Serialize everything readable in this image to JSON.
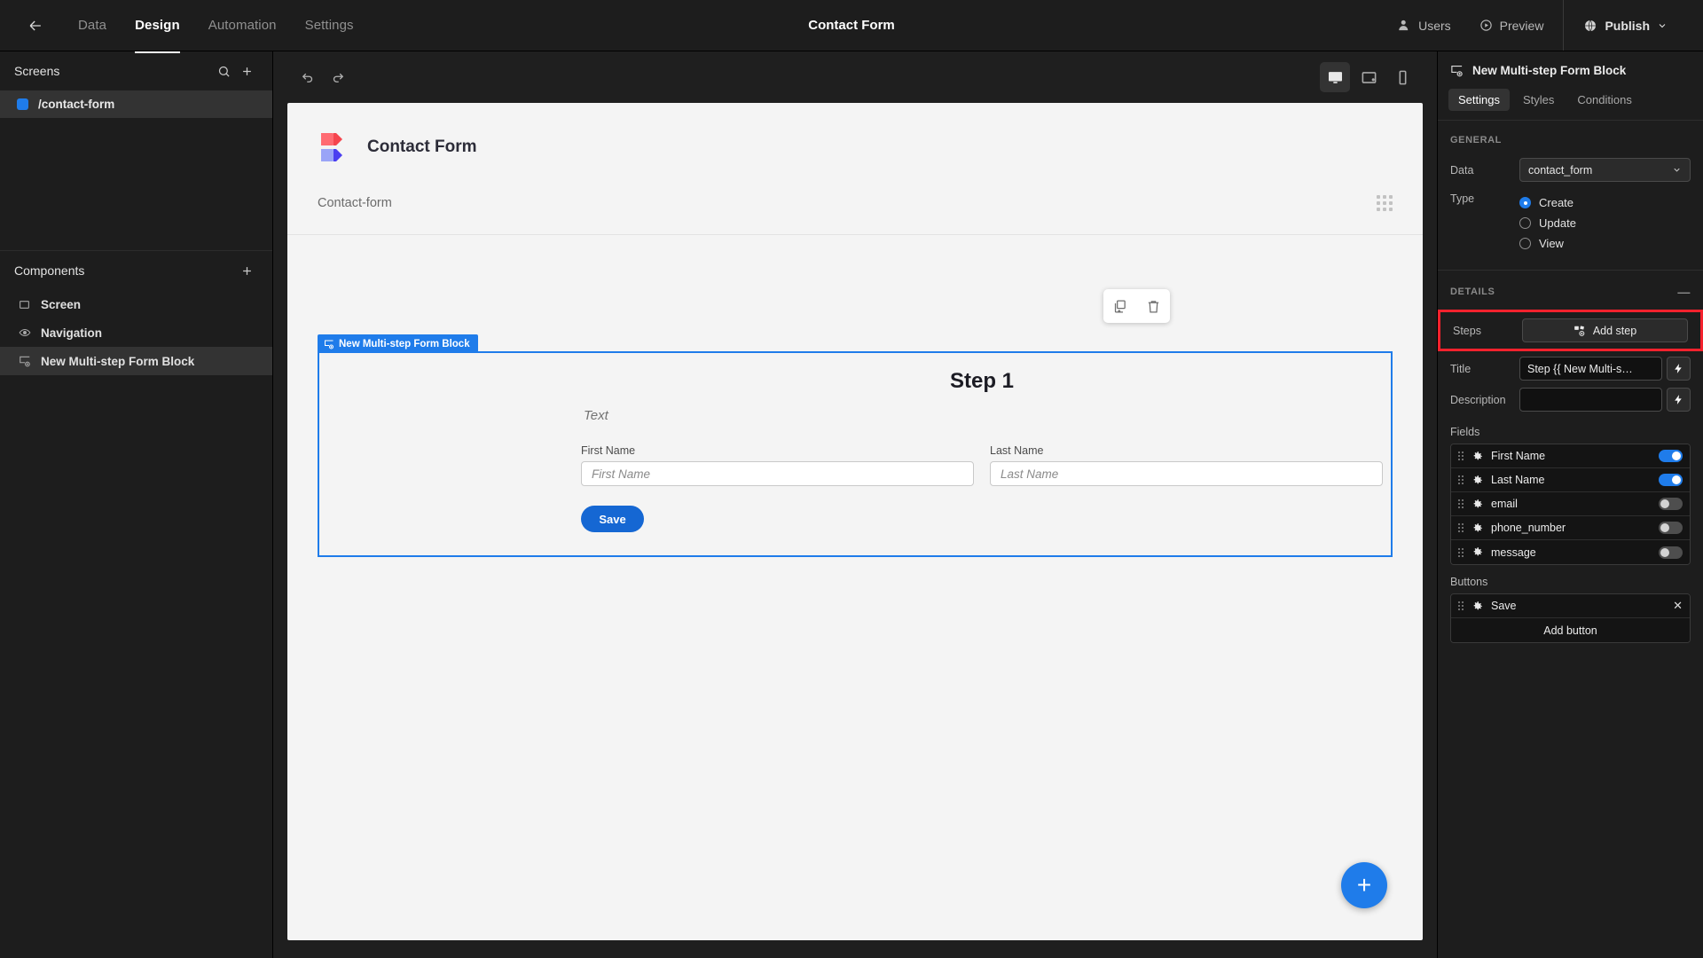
{
  "topbar": {
    "back_icon": "arrow-left-icon",
    "tabs": [
      {
        "label": "Data",
        "active": false
      },
      {
        "label": "Design",
        "active": true
      },
      {
        "label": "Automation",
        "active": false
      },
      {
        "label": "Settings",
        "active": false
      }
    ],
    "title": "Contact Form",
    "users_label": "Users",
    "preview_label": "Preview",
    "publish_label": "Publish"
  },
  "sidebar": {
    "screens_title": "Screens",
    "screens": [
      {
        "label": "/contact-form",
        "color": "#1f7cea",
        "selected": true
      }
    ],
    "components_title": "Components",
    "components": [
      {
        "label": "Screen",
        "icon": "screen-icon",
        "selected": false
      },
      {
        "label": "Navigation",
        "icon": "eye-icon",
        "selected": false
      },
      {
        "label": "New Multi-step Form Block",
        "icon": "form-block-icon",
        "selected": true
      }
    ]
  },
  "canvas": {
    "undo_icon": "undo-icon",
    "redo_icon": "redo-icon",
    "devices": [
      {
        "name": "desktop",
        "active": true
      },
      {
        "name": "tablet",
        "active": false
      },
      {
        "name": "mobile",
        "active": false
      }
    ],
    "app_name": "Contact Form",
    "breadcrumb": "Contact-form",
    "float_toolbar": [
      {
        "name": "duplicate-icon"
      },
      {
        "name": "delete-icon"
      }
    ],
    "block_tag": "New Multi-step Form Block",
    "step_title": "Step 1",
    "step_text": "Text",
    "fields": [
      {
        "label": "First Name",
        "placeholder": "First Name"
      },
      {
        "label": "Last Name",
        "placeholder": "Last Name"
      }
    ],
    "save_label": "Save",
    "fab_label": "+"
  },
  "rightpanel": {
    "header_title": "New Multi-step Form Block",
    "tabs": [
      {
        "label": "Settings",
        "active": true
      },
      {
        "label": "Styles",
        "active": false
      },
      {
        "label": "Conditions",
        "active": false
      }
    ],
    "general_title": "GENERAL",
    "data_label": "Data",
    "data_value": "contact_form",
    "type_label": "Type",
    "type_options": [
      {
        "label": "Create",
        "checked": true
      },
      {
        "label": "Update",
        "checked": false
      },
      {
        "label": "View",
        "checked": false
      }
    ],
    "details_title": "DETAILS",
    "steps_label": "Steps",
    "add_step_label": "Add step",
    "title_label": "Title",
    "title_value": "Step {{ New Multi-s…",
    "description_label": "Description",
    "description_value": "",
    "fields_label": "Fields",
    "fields_master_on": true,
    "fields": [
      {
        "label": "First Name",
        "on": true
      },
      {
        "label": "Last Name",
        "on": true
      },
      {
        "label": "email",
        "on": false
      },
      {
        "label": "phone_number",
        "on": false
      },
      {
        "label": "message",
        "on": false
      }
    ],
    "buttons_label": "Buttons",
    "buttons": [
      {
        "label": "Save"
      }
    ],
    "add_button_label": "Add button",
    "accent_color": "#1f7cea",
    "highlight_color": "#f4222d"
  }
}
